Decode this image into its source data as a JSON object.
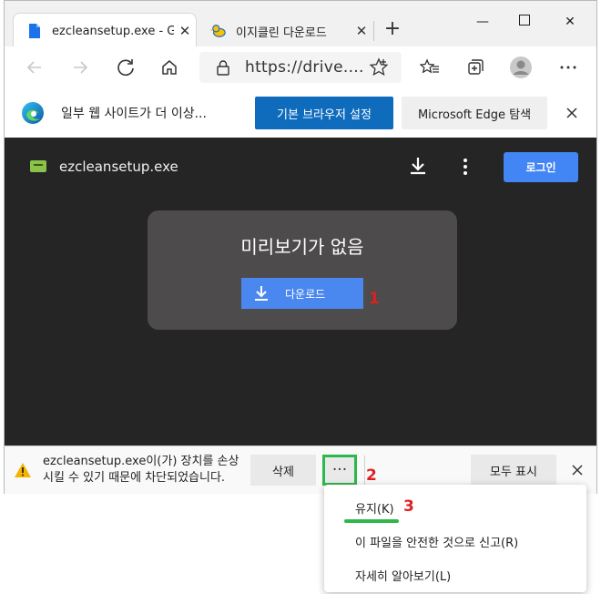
{
  "tabs": [
    {
      "title": "ezcleansetup.exe - G",
      "active": true,
      "icon": "document-icon"
    },
    {
      "title": "이지클린 다운로드",
      "active": false,
      "icon": "rubber-duck-icon"
    }
  ],
  "toolbar": {
    "url": "https://drive....",
    "icons": [
      "back-icon",
      "forward-icon",
      "refresh-icon",
      "home-icon",
      "lock-icon",
      "favorite-star-icon",
      "favorites-icon",
      "collections-icon",
      "profile-icon",
      "settings-more-icon"
    ]
  },
  "infobar": {
    "message": "일부 웹 사이트가 더 이상...",
    "primary_button": "기본 브라우저 설정",
    "secondary_button": "Microsoft Edge 탐색"
  },
  "viewer": {
    "filename": "ezcleansetup.exe",
    "login_button": "로그인",
    "no_preview": "미리보기가 없음",
    "download_button": "다운로드"
  },
  "annotations": [
    "1",
    "2",
    "3"
  ],
  "download_shelf": {
    "warning_line1": "ezcleansetup.exe이(가) 장치를 손상",
    "warning_line2": "시킬 수 있기 때문에 차단되었습니다.",
    "delete_button": "삭제",
    "more_button": "···",
    "show_all_button": "모두 표시"
  },
  "context_menu": [
    {
      "label": "유지(K)"
    },
    {
      "label": "이 파일을 안전한 것으로 신고(R)"
    },
    {
      "label": "자세히 알아보기(L)"
    }
  ],
  "colors": {
    "accent_blue": "#0f6cbd",
    "drive_blue": "#4a88f0",
    "highlight_green": "#2eb84b",
    "annotation_red": "#e02020",
    "viewer_background": "#252525"
  }
}
